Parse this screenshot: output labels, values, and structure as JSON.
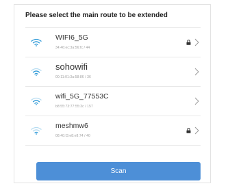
{
  "dialog": {
    "title": "Please select the main route to be extended",
    "networks": [
      {
        "ssid": "WIFI6_5G",
        "mac": "34:46:ec:3a:56:fc / 44",
        "locked": true,
        "big": false
      },
      {
        "ssid": "sohowifi",
        "mac": "00:11:01:3a:58:86 / 36",
        "locked": false,
        "big": true
      },
      {
        "ssid": "wifi_5G_77553C",
        "mac": "b8:55:73:77:55:3c / 157",
        "locked": false,
        "big": false
      },
      {
        "ssid": "meshmw6",
        "mac": "08:40:f3:e8:e8:74 / 40",
        "locked": true,
        "big": false
      }
    ],
    "scan_label": "Scan"
  },
  "colors": {
    "accent": "#4d8fd7",
    "wifi_icon": "#2f9ad8",
    "text": "#333333",
    "muted": "#a0a0a0"
  }
}
